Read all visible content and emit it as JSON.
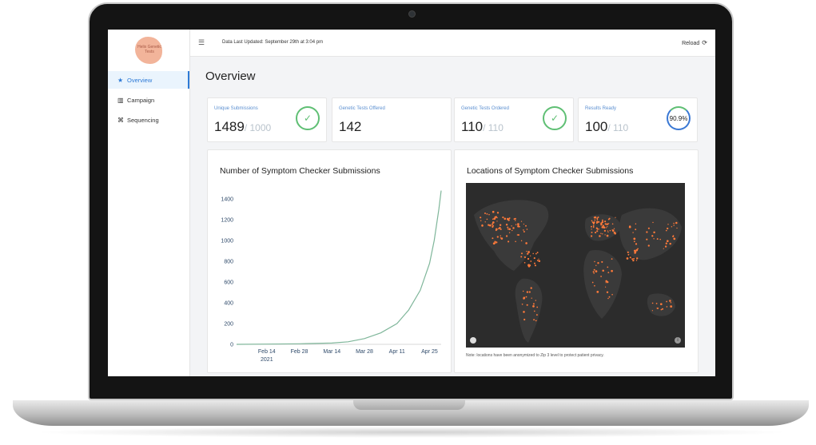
{
  "sidebar": {
    "logo_text": "Helix Genetic Tests",
    "items": [
      {
        "label": "Overview",
        "icon": "star-icon"
      },
      {
        "label": "Campaign",
        "icon": "bar-chart-icon"
      },
      {
        "label": "Sequencing",
        "icon": "dna-icon"
      }
    ]
  },
  "topbar": {
    "updated": "Data Last Updated: September 29th at 3:04 pm",
    "reload": "Reload"
  },
  "page": {
    "title": "Overview"
  },
  "stats": [
    {
      "label": "Unique Submissions",
      "value": "1489",
      "sub": "/ 1000"
    },
    {
      "label": "Genetic Tests Offered",
      "value": "142",
      "sub": ""
    },
    {
      "label": "Genetic Tests Ordered",
      "value": "110",
      "sub": "/ 110"
    },
    {
      "label": "Results Ready",
      "value": "100",
      "sub": "/ 110",
      "percent": "90.9%"
    }
  ],
  "panels": {
    "chart_title": "Number of Symptom Checker Submissions",
    "map_title": "Locations of Symptom Checker Submissions",
    "map_note": "Note: locations have been anonymized to Zip 3 level to protect patient privacy."
  },
  "colors": {
    "accent": "#2d7ad6",
    "line": "#7fb69a",
    "ring_green": "#5fbf74",
    "ring_blue": "#3a78d4",
    "map_bg": "#2c2c2c",
    "map_dots": "#ff7a3a"
  },
  "chart_data": {
    "type": "line",
    "title": "Number of Symptom Checker Submissions",
    "xlabel": "",
    "ylabel": "",
    "x_tick_labels": [
      "Feb 14\n2021",
      "Feb 28",
      "Mar 14",
      "Mar 28",
      "Apr 11",
      "Apr 25"
    ],
    "y_ticks": [
      0,
      200,
      400,
      600,
      800,
      1000,
      1200,
      1400
    ],
    "ylim": [
      0,
      1400
    ],
    "x_range": [
      "2021-02-01",
      "2021-04-30"
    ],
    "series": [
      {
        "x": [
          "2021-02-01",
          "2021-02-14",
          "2021-02-28",
          "2021-03-14",
          "2021-03-21",
          "2021-03-28",
          "2021-04-04",
          "2021-04-11",
          "2021-04-16",
          "2021-04-21",
          "2021-04-25",
          "2021-04-27",
          "2021-04-29",
          "2021-04-30"
        ],
        "y": [
          0,
          2,
          5,
          12,
          25,
          55,
          110,
          200,
          330,
          520,
          780,
          1000,
          1300,
          1480
        ]
      }
    ],
    "grid": false,
    "legend": "none"
  }
}
